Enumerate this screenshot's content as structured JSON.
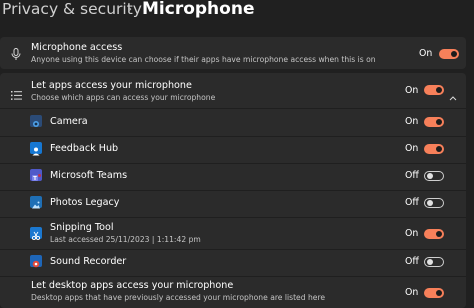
{
  "breadcrumb": {
    "parent": "Privacy & security",
    "separator": "›",
    "current": "Microphone"
  },
  "mic_access": {
    "title": "Microphone access",
    "subtitle": "Anyone using this device can choose if their apps have microphone access when this is on",
    "state": "On",
    "icon": "microphone-icon"
  },
  "let_apps": {
    "title": "Let apps access your microphone",
    "subtitle": "Choose which apps can access your microphone",
    "state": "On",
    "icon": "list-icon",
    "chevron": "chevron-up-icon"
  },
  "apps": [
    {
      "name": "Camera",
      "state": "On"
    },
    {
      "name": "Feedback Hub",
      "state": "On"
    },
    {
      "name": "Microsoft Teams",
      "state": "Off"
    },
    {
      "name": "Photos Legacy",
      "state": "Off"
    },
    {
      "name": "Snipping Tool",
      "last": "Last accessed 25/11/2023 | 1:11:42 pm",
      "state": "On"
    },
    {
      "name": "Sound Recorder",
      "state": "Off"
    }
  ],
  "desktop": {
    "title": "Let desktop apps access your microphone",
    "subtitle": "Desktop apps that have previously accessed your microphone are listed here",
    "state": "On"
  },
  "colors": {
    "accent": "#f7805a",
    "background": "#202020",
    "card": "#2b2b2b"
  }
}
